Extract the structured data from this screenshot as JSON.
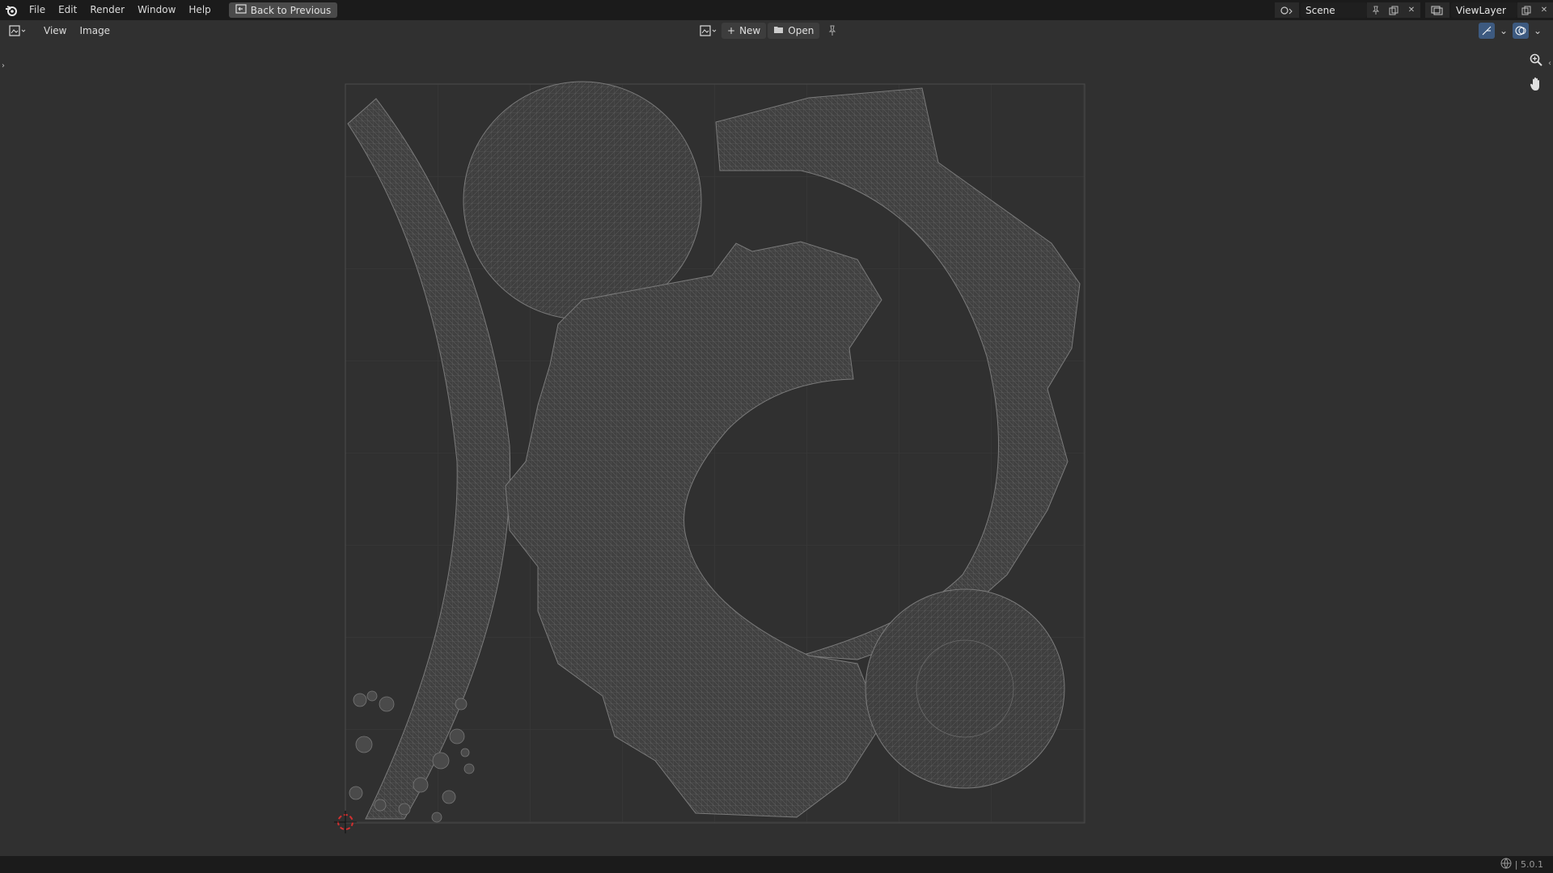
{
  "topbar": {
    "menus": [
      "File",
      "Edit",
      "Render",
      "Window",
      "Help"
    ],
    "back_button": "Back to Previous",
    "scene_name": "Scene",
    "view_layer": "ViewLayer"
  },
  "editor_header": {
    "menus": [
      "View",
      "Image"
    ],
    "new_label": "New",
    "open_label": "Open"
  },
  "status": {
    "version": "| 5.0.1"
  },
  "icons": [
    "blender-logo-icon",
    "back-icon",
    "scene-icon",
    "pin-icon",
    "copy-icon",
    "close-icon",
    "view-layer-icon",
    "image-editor-icon",
    "image-browse-icon",
    "plus-icon",
    "folder-icon",
    "gizmo-icon",
    "overlay-icon",
    "zoom-icon",
    "hand-icon",
    "network-icon",
    "cursor-icon"
  ],
  "colors": {
    "background": "#303030",
    "topbar": "#1b1b1b",
    "uv_wire": "#707070",
    "cursor": "#d03030"
  }
}
